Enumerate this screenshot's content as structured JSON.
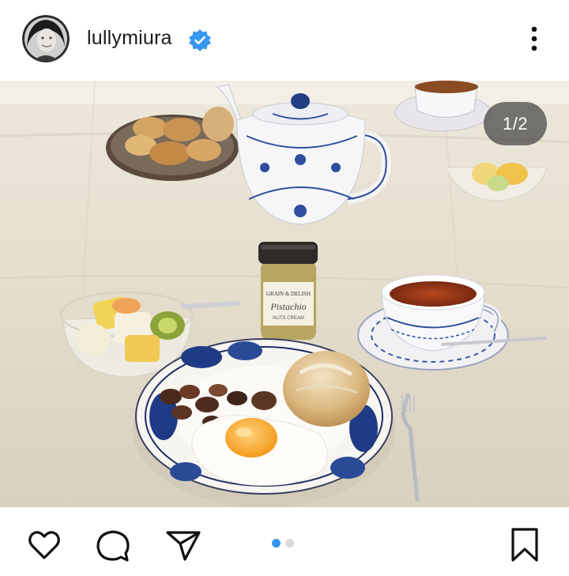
{
  "post": {
    "username": "lullymiura",
    "verified": true,
    "image_counter": "1/2",
    "carousel_total": 2,
    "carousel_active": 1
  },
  "icons": {
    "verified": "verified-badge-icon",
    "more": "more-vertical-icon",
    "like": "heart-icon",
    "comment": "comment-icon",
    "share": "share-paper-plane-icon",
    "save": "bookmark-icon"
  },
  "colors": {
    "verified_blue": "#3897f0",
    "dot_active": "#3897f0",
    "dot_inactive": "#d9d9d9",
    "icon": "#111111"
  }
}
